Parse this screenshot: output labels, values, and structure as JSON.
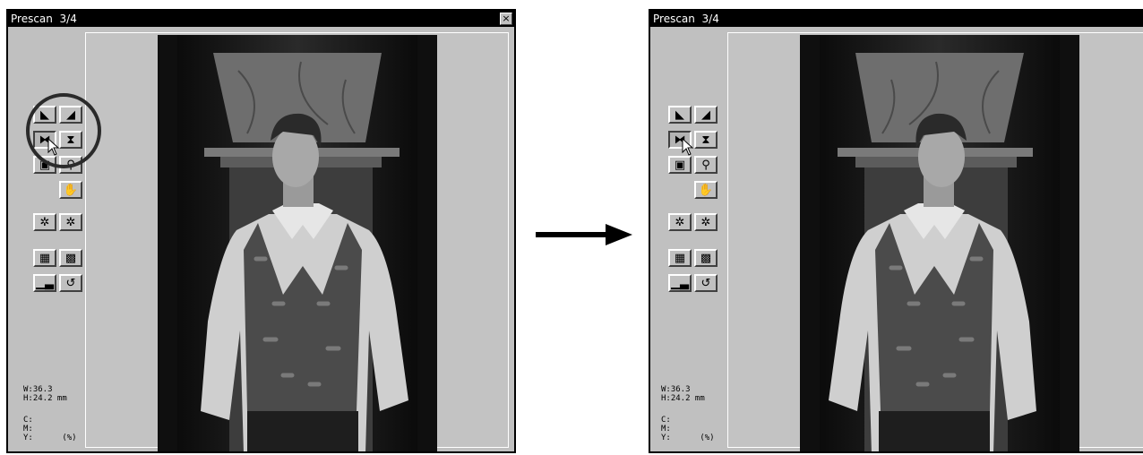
{
  "windows": [
    {
      "title": "Prescan  3/4",
      "close_glyph": "×",
      "readout": {
        "w": "W:36.3",
        "h": "H:24.2 mm",
        "c": "C:",
        "m": "M:",
        "y": "Y:      (%)"
      }
    },
    {
      "title": "Prescan  3/4",
      "readout": {
        "w": "W:36.3",
        "h": "H:24.2 mm",
        "c": "C:",
        "m": "M:",
        "y": "Y:      (%)"
      }
    }
  ],
  "tools": [
    {
      "name": "rotate-left-icon"
    },
    {
      "name": "rotate-right-icon"
    },
    {
      "name": "flip-horizontal-icon",
      "state": "pressed"
    },
    {
      "name": "flip-vertical-icon"
    },
    {
      "name": "crop-frame-icon"
    },
    {
      "name": "zoom-icon"
    },
    {
      "name": "hand-icon"
    },
    {
      "name": "manual-focus-icon"
    },
    {
      "name": "auto-focus-icon"
    },
    {
      "name": "image-correction-icon"
    },
    {
      "name": "variations-icon"
    },
    {
      "name": "histogram-icon"
    },
    {
      "name": "undo-icon"
    }
  ],
  "colors": {
    "window_bg": "#c0c0c0",
    "title_bg": "#000000",
    "title_fg": "#ffffff",
    "highlight_circle": "#2a2a2a"
  }
}
